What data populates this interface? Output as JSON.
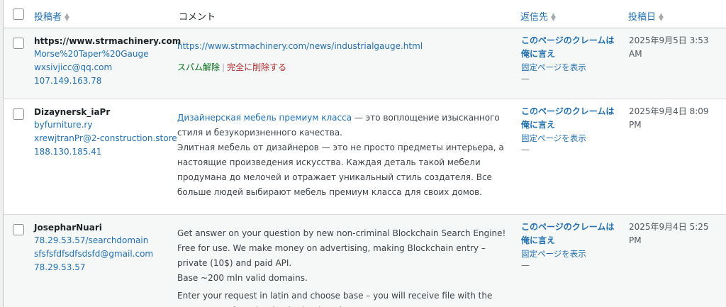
{
  "headers": {
    "author": "投稿者",
    "comment": "コメント",
    "response": "返信先",
    "submitted": "投稿日"
  },
  "rows": [
    {
      "author_name": "https://www.strmachinery.com",
      "author_url": "Morse%20Taper%20Gauge",
      "email": "wxsivjicc@qq.com",
      "ip": "107.149.163.78",
      "comment_link": "https://www.strmachinery.com/news/industrialgauge.html",
      "actions": {
        "not_spam": "スパム解除",
        "separator": "|",
        "delete": "完全に削除する"
      },
      "response_title": "このページのクレームは俺に言え",
      "response_view": "固定ページを表示",
      "response_dash": "—",
      "date": "2025年9月5日 3:53 AM"
    },
    {
      "author_name": "Dizaynersk_iaPr",
      "author_url": "byfurniture.ry",
      "email": "xrewjtranPr@2-construction.store",
      "ip": "188.130.185.41",
      "comment_link": "Дизайнерская мебель премиум класса",
      "comment_after_link": " — это воплощение изысканного стиля и безукоризненного качества.",
      "comment_p2": "Элитная мебель от дизайнеров — это не просто предметы интерьера, а настоящие произведения искусства. Каждая деталь такой мебели продумана до мелочей и отражает уникальный стиль создателя. Все больше людей выбирают мебель премиум класса для своих домов.",
      "response_title": "このページのクレームは俺に言え",
      "response_view": "固定ページを表示",
      "response_dash": "—",
      "date": "2025年9月4日 8:09 PM"
    },
    {
      "author_name": "JosepharNuari",
      "author_url": "78.29.53.57/searchdomain",
      "email": "sfsfsfdfsdfsdsfd@gmail.com",
      "ip": "78.29.53.57",
      "comment_p1": "Get answer on your question by new non-criminal Blockchain Search Engine!",
      "comment_p2": "Free for use. We make money on advertising, making Blockchain entry – private (10$) and paid API.",
      "comment_p3": "Base ~200 mln valid domains.",
      "comment_p4": "Enter your request in latin and choose base – you will receive file with the occurrence of a substring in the domain",
      "response_title": "このページのクレームは俺に言え",
      "response_view": "固定ページを表示",
      "response_dash": "—",
      "date": "2025年9月4日 5:25 PM"
    }
  ]
}
